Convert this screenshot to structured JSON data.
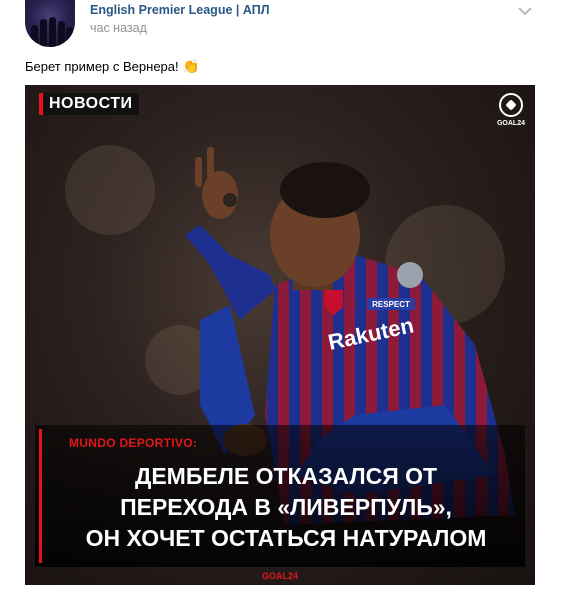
{
  "post": {
    "author": "English Premier League | АПЛ",
    "time": "час назад",
    "text": "Берет пример с Вернера!",
    "emoji": "👏"
  },
  "image": {
    "badge": "НОВОСТИ",
    "brand": "GOAL24",
    "source": "MUNDO DEPORTIVO:",
    "headline_lines": [
      "ДЕМБЕЛЕ ОТКАЗАЛСЯ ОТ",
      "ПЕРЕХОДА В «ЛИВЕРПУЛЬ»,",
      "ОН ХОЧЕТ ОСТАТЬСЯ НАТУРАЛОМ"
    ],
    "footer_brand": "GOAL24",
    "shirt_sponsor": "Rakuten",
    "sleeve_patch": "RESPECT"
  },
  "colors": {
    "link": "#2a5885",
    "muted": "#939393",
    "accent_red": "#e3151a"
  }
}
